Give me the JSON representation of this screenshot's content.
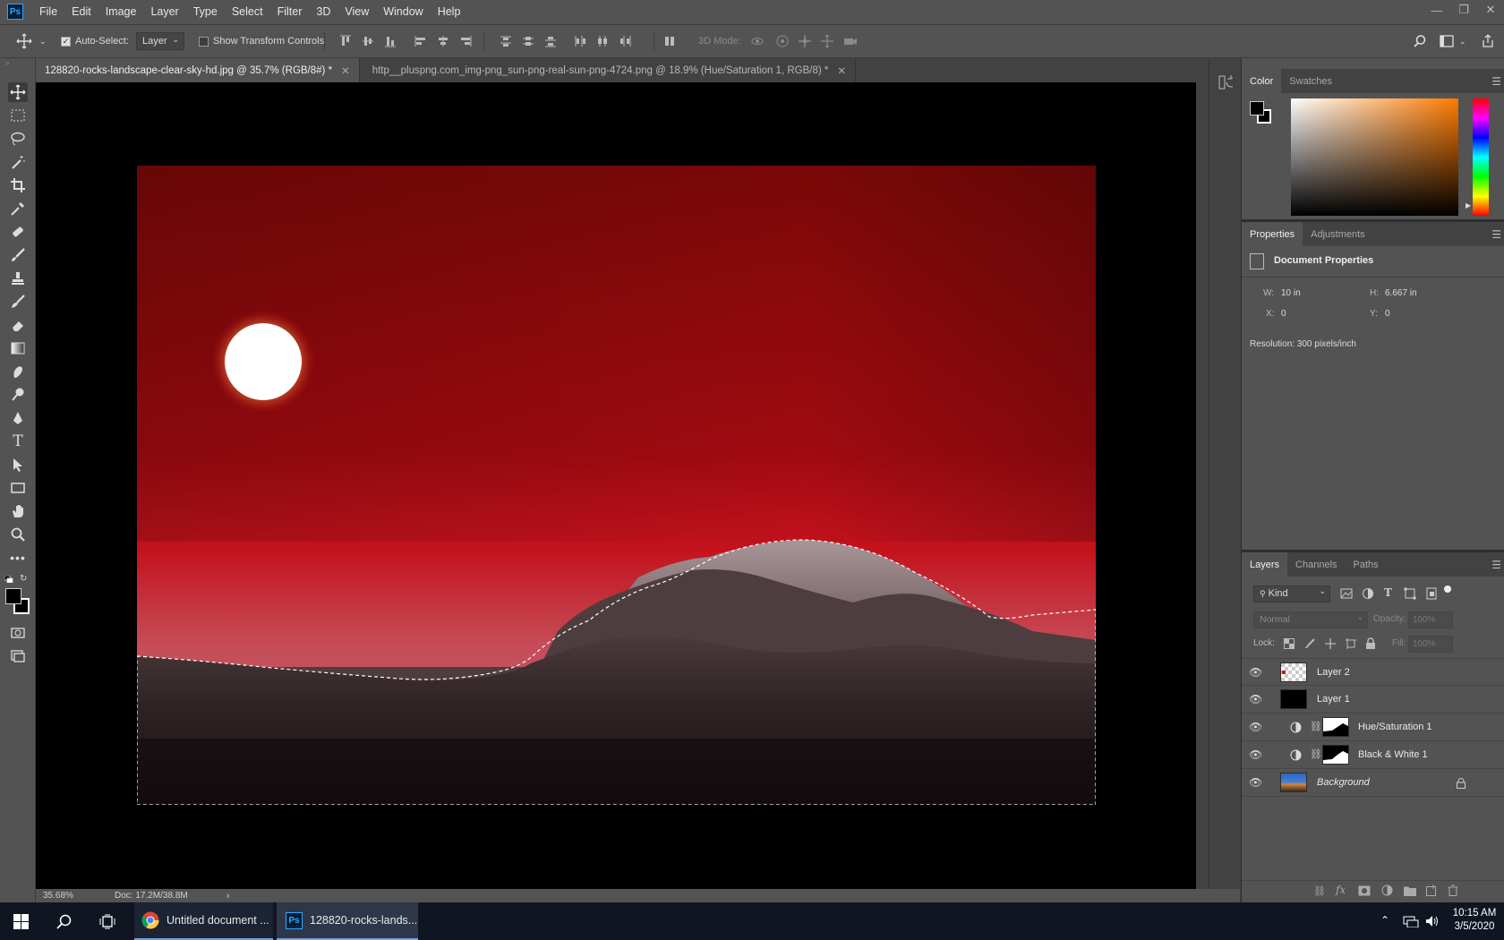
{
  "app": {
    "name": "Ps"
  },
  "menu": [
    "File",
    "Edit",
    "Image",
    "Layer",
    "Type",
    "Select",
    "Filter",
    "3D",
    "View",
    "Window",
    "Help"
  ],
  "options": {
    "auto_select_label": "Auto-Select:",
    "auto_select_checked": true,
    "target_value": "Layer",
    "transform_controls_label": "Show Transform Controls",
    "mode_3d_label": "3D Mode:"
  },
  "tabs": [
    {
      "label": "128820-rocks-landscape-clear-sky-hd.jpg @ 35.7% (RGB/8#) *",
      "active": true
    },
    {
      "label": "http__pluspng.com_img-png_sun-png-real-sun-png-4724.png @ 18.9% (Hue/Saturation 1, RGB/8) *",
      "active": false
    }
  ],
  "status": {
    "zoom": "35.68%",
    "doc": "Doc: 17.2M/38.8M"
  },
  "color_panel": {
    "tabs": [
      "Color",
      "Swatches"
    ],
    "foreground": "#000000",
    "background": "#ffffff",
    "hue_color": "#ff7a00"
  },
  "properties": {
    "tabs": [
      "Properties",
      "Adjustments"
    ],
    "title": "Document Properties",
    "w_label": "W:",
    "w_value": "10 in",
    "h_label": "H:",
    "h_value": "6.667 in",
    "x_label": "X:",
    "x_value": "0",
    "y_label": "Y:",
    "y_value": "0",
    "resolution": "Resolution: 300 pixels/inch"
  },
  "layers_panel": {
    "tabs": [
      "Layers",
      "Channels",
      "Paths"
    ],
    "kind_label": "Kind",
    "blend_mode": "Normal",
    "opacity_label": "Opacity:",
    "opacity_value": "100%",
    "lock_label": "Lock:",
    "fill_label": "Fill:",
    "fill_value": "100%",
    "layers": [
      {
        "name": "Layer 2",
        "type": "transparent",
        "italic": false
      },
      {
        "name": "Layer 1",
        "type": "black",
        "italic": false
      },
      {
        "name": "Hue/Saturation 1",
        "type": "adjustment",
        "italic": false
      },
      {
        "name": "Black & White 1",
        "type": "adjustment",
        "italic": false
      },
      {
        "name": "Background",
        "type": "image",
        "italic": true
      }
    ]
  },
  "taskbar": {
    "items": [
      {
        "label": "Untitled document ...",
        "app": "chrome"
      },
      {
        "label": "128820-rocks-lands...",
        "app": "photoshop"
      }
    ],
    "time": "10:15 AM",
    "date": "3/5/2020"
  }
}
